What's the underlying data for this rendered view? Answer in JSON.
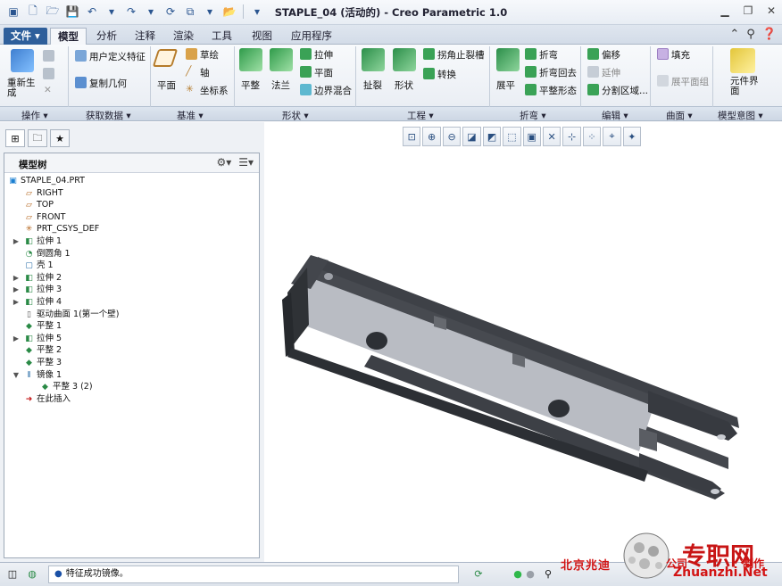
{
  "window": {
    "title": "STAPLE_04 (活动的) - Creo Parametric 1.0"
  },
  "tabs": [
    {
      "label": "文件"
    },
    {
      "label": "模型"
    },
    {
      "label": "分析"
    },
    {
      "label": "注释"
    },
    {
      "label": "渲染"
    },
    {
      "label": "工具"
    },
    {
      "label": "视图"
    },
    {
      "label": "应用程序"
    }
  ],
  "ribbon": {
    "regenerate": "重新生成",
    "udf": "用户定义特征",
    "copy_geom": "复制几何",
    "plane": "平面",
    "sketch": "草绘",
    "axis": "轴",
    "csys": "坐标系",
    "flatten": "平整",
    "flange": "法兰",
    "extrude": "拉伸",
    "planar": "平面",
    "boundary_blend": "边界混合",
    "rip": "扯裂",
    "form": "形状",
    "corner_relief": "拐角止裂槽",
    "convert": "转换",
    "unbend": "展平",
    "bend": "折弯",
    "bend_back": "折弯回去",
    "flat_state": "平整形态",
    "offset": "偏移",
    "extend": "延伸",
    "split_area": "分割区域...",
    "fill": "填充",
    "flat_panel": "展平面组",
    "component_interface": "元件界面"
  },
  "groups": {
    "operations": "操作",
    "get_data": "获取数据",
    "datum": "基准",
    "shapes": "形状",
    "engineering": "工程",
    "bends": "折弯",
    "editing": "编辑",
    "surfaces": "曲面",
    "model_intent": "模型意图"
  },
  "model_tree": {
    "title": "模型树",
    "items": [
      {
        "label": "STAPLE_04.PRT"
      },
      {
        "label": "RIGHT"
      },
      {
        "label": "TOP"
      },
      {
        "label": "FRONT"
      },
      {
        "label": "PRT_CSYS_DEF"
      },
      {
        "label": "拉伸 1"
      },
      {
        "label": "倒圆角 1"
      },
      {
        "label": "壳 1"
      },
      {
        "label": "拉伸 2"
      },
      {
        "label": "拉伸 3"
      },
      {
        "label": "拉伸 4"
      },
      {
        "label": "驱动曲面 1(第一个壁)"
      },
      {
        "label": "平整 1"
      },
      {
        "label": "拉伸 5"
      },
      {
        "label": "平整 2"
      },
      {
        "label": "平整 3"
      },
      {
        "label": "镜像 1"
      },
      {
        "label": "平整 3 (2)"
      },
      {
        "label": "在此插入"
      }
    ]
  },
  "status": {
    "message": "特征成功镜像。"
  },
  "watermark": {
    "site": "北京兆迪",
    "company": "公司",
    "make": "制作",
    "logo": "专职网",
    "domain": "Zhuanzhi.Net"
  },
  "colors": {
    "accent": "#2e5f9b",
    "part_dark": "#4a4c52",
    "part_light": "#b9bcc3",
    "insert_here": "#c41818"
  }
}
